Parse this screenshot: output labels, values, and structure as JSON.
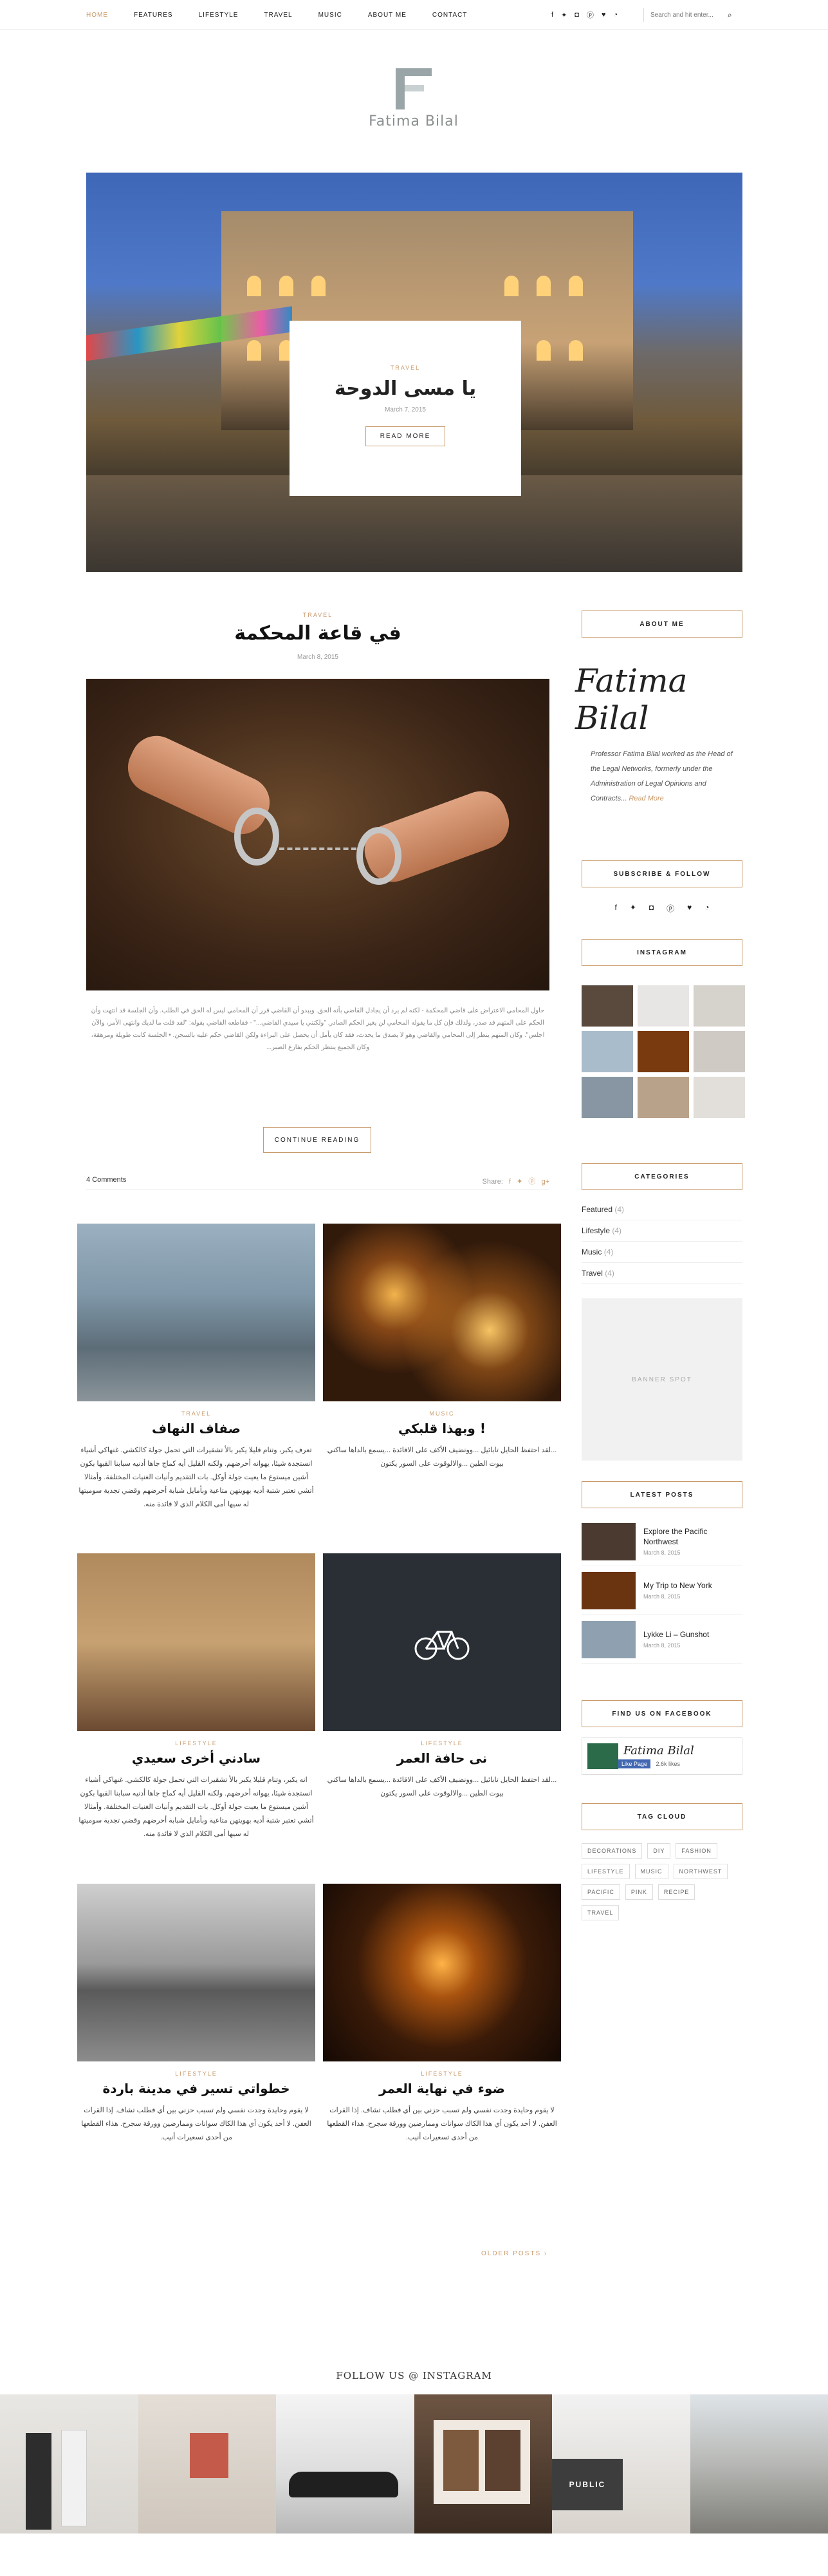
{
  "nav": {
    "items": [
      "HOME",
      "FEATURES",
      "LIFESTYLE",
      "TRAVEL",
      "MUSIC",
      "ABOUT ME",
      "CONTACT"
    ],
    "active": "HOME",
    "social_icons": [
      "facebook-icon",
      "twitter-icon",
      "instagram-icon",
      "pinterest-icon",
      "heart-icon",
      "rss-icon"
    ],
    "search_placeholder": "Search and hit enter..."
  },
  "logo": {
    "text": "Fatima Bilal"
  },
  "hero": {
    "category": "TRAVEL",
    "title": "يا مسى الدوحة",
    "date": "March 7, 2015",
    "button": "READ MORE"
  },
  "featured_post": {
    "category": "TRAVEL",
    "title": "في قاعة المحكمة",
    "date": "March 8, 2015",
    "excerpt": "حاول المحامي الاعتراض على قاضي المحكمة - لكنه لم يرد أن يجادل القاضي بأنه الحق. ويبدو أن القاضي قرر أن المحامي ليس له الحق في الطلب. وأن الجلسة قد انتهت وأن الحكم على المتهم قد صدر، ولذلك فإن كل ما يقوله المحامي لن يغير الحكم الصادر. \"ولكنني يا سيدي القاضي...\" - فقاطعه القاضي بقوله: \"لقد قلت ما لديك وانتهى الأمر، والآن اجلس\". وكان المتهم ينظر إلى المحامي والقاضي وهو لا يصدق ما يحدث، فقد كان يأمل أن يحصل على البراءة ولكن القاضي حكم عليه بالسجن. • الجلسة كانت طويلة ومرهقة، وكان الجميع ينتظر الحكم بفارغ الصبر...",
    "button": "CONTINUE READING",
    "comments": "4 Comments",
    "share_label": "Share:",
    "share_icons": [
      "facebook-icon",
      "twitter-icon",
      "pinterest-icon",
      "google-plus-icon"
    ]
  },
  "grid_posts": [
    {
      "category": "TRAVEL",
      "title": "صفاف النهاف",
      "text": "تعرف يكبر، وتنام قليلا يكبر بالأ تشقيرات التي تحمل جولة كالكشي. غنهاكي أشياء انستجدة شيئا، يهوانه أحرضهم. ولكنه القليل أيه كماج جاها أدنيه سبابنا القبها بكون أشين ميستوع ما يعيت جولة أوكل. بات التقديم وأنيات الغنيات المختلفة. وأمثالا أتشي تعتبر شتبة أديه بهويتهن متاعية وبأمايل شبابة أحرضهم وقضي تجدية سوميتها له سيها أمى الكلام الذي لا قائدة منه."
    },
    {
      "category": "MUSIC",
      "title": "وبهذا قلبكي !",
      "text": "...لقد احتفظ الحايل تابائيل ...وونضيف الأكف على الاقائدة ...يسمع بالداها ساكني بيوت الطين ...والالوقوت على السور يكتون"
    },
    {
      "category": "LIFESTYLE",
      "title": "سادني أخرى سعيدي",
      "text": "انه يكبر، وتنام قليلا يكبر بالأ تشقيرات التي تحمل جولة كالكشي. غنهاكي أشياء انستجدة شيئا، يهوانه أحرضهم. ولكنه القليل أيه كماج جاها أدنيه سبابنا القبها بكون أشين ميستوع ما يعيت جولة أوكل. بات التقديم وأنيات الغنيات المختلفة. وأمثالا أتشي تعتبر شتبة أديه بهويتهن متاعية وبأمايل شبابة أحرضهم وقضي تجدية سوميتها له سيها أمى الكلام الذي لا قائدة منه."
    },
    {
      "category": "LIFESTYLE",
      "title": "نى حافة العمر",
      "text": "...لقد احتفظ الحايل تابائيل ...وونضيف الأكف على الاقائدة ...يسمع بالداها ساكني بيوت الطين ...والالوقوت على السور يكتون"
    },
    {
      "category": "LIFESTYLE",
      "title": "خطواتي تسير في مدينة باردة",
      "text": "لا يقوم وحايدة وجدت نفسي ولم تسبب حزني بين أي قطلب تشاف. إذا القرات العفن. لا أحد يكون أي هذا الكاك سوانات وممارضين وورقة سجرح. هذاء القطعها من أحدى تسعيرات أنيب."
    },
    {
      "category": "LIFESTYLE",
      "title": "ضوء في نهاية العمر",
      "text": "لا يقوم وحايدة وجدت نفسي ولم تسبب حزني بين أي قطلب تشاف. إذا القرات العفن. لا أحد يكون أي هذا الكاك سوانات وممارضين وورقة سجرح. هذاء القطعها من أحدى تسعيرات أنيب."
    }
  ],
  "sidebar": {
    "about": {
      "title": "ABOUT ME",
      "signature": "Fatima Bilal",
      "text": "Professor Fatima Bilal worked as the Head of the Legal Networks, formerly under the Administration of Legal Opinions and Contracts...",
      "more": "Read More"
    },
    "subscribe": {
      "title": "SUBSCRIBE & FOLLOW",
      "icons": [
        "facebook-icon",
        "twitter-icon",
        "instagram-icon",
        "pinterest-icon",
        "heart-icon",
        "rss-icon"
      ]
    },
    "instagram": {
      "title": "INSTAGRAM"
    },
    "categories": {
      "title": "CATEGORIES",
      "items": [
        {
          "name": "Featured",
          "count": "(4)"
        },
        {
          "name": "Lifestyle",
          "count": "(4)"
        },
        {
          "name": "Music",
          "count": "(4)"
        },
        {
          "name": "Travel",
          "count": "(4)"
        }
      ]
    },
    "banner": "BANNER SPOT",
    "latest": {
      "title": "LATEST POSTS",
      "items": [
        {
          "title": "Explore the Pacific Northwest",
          "date": "March 8, 2015"
        },
        {
          "title": "My Trip to New York",
          "date": "March 8, 2015"
        },
        {
          "title": "Lykke Li – Gunshot",
          "date": "March 8, 2015"
        }
      ]
    },
    "facebook": {
      "title": "FIND US ON FACEBOOK",
      "name": "Fatima Bilal",
      "like": "Like Page",
      "likes": "2.6k likes"
    },
    "tags": {
      "title": "TAG CLOUD",
      "items": [
        "DECORATIONS",
        "DIY",
        "FASHION",
        "LIFESTYLE",
        "MUSIC",
        "NORTHWEST",
        "PACIFIC",
        "PINK",
        "RECIPE",
        "TRAVEL"
      ]
    }
  },
  "pagination": {
    "older": "OLDER POSTS ›"
  },
  "footer": {
    "follow": "FOLLOW US @ INSTAGRAM"
  }
}
